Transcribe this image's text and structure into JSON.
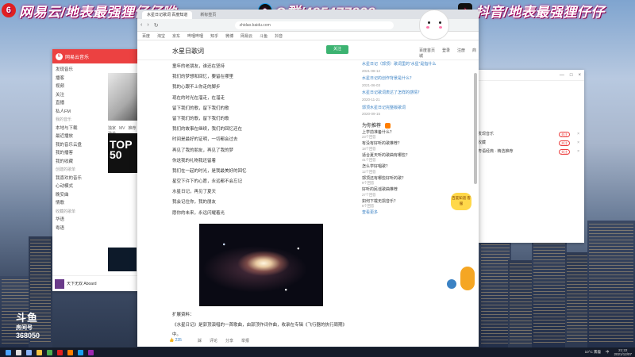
{
  "banners": {
    "left": {
      "logo": "6",
      "text": "网易云/地表最强狸仔仔哟"
    },
    "mid": {
      "text": "Q群/485477828"
    },
    "right": {
      "text": "抖音/地表最强狸仔仔"
    }
  },
  "music_window": {
    "app_title": "网易云音乐",
    "sidebar_items": [
      {
        "label": "发现音乐",
        "type": "item"
      },
      {
        "label": "播客",
        "type": "item"
      },
      {
        "label": "视频",
        "type": "item"
      },
      {
        "label": "关注",
        "type": "item"
      },
      {
        "label": "直播",
        "type": "item"
      },
      {
        "label": "私人FM",
        "type": "item"
      },
      {
        "label": "我的音乐",
        "type": "group"
      },
      {
        "label": "本地与下载",
        "type": "item"
      },
      {
        "label": "最近播放",
        "type": "item"
      },
      {
        "label": "我的音乐云盘",
        "type": "item"
      },
      {
        "label": "我的播客",
        "type": "item"
      },
      {
        "label": "我的收藏",
        "type": "item"
      },
      {
        "label": "创建的歌单",
        "type": "group"
      },
      {
        "label": "我喜欢的音乐",
        "type": "item"
      },
      {
        "label": "心动模式",
        "type": "item"
      },
      {
        "label": "晚安曲",
        "type": "item"
      },
      {
        "label": "情歌",
        "type": "item"
      },
      {
        "label": "收藏的歌单",
        "type": "group"
      },
      {
        "label": "华语",
        "type": "item"
      },
      {
        "label": "粤语",
        "type": "item"
      }
    ],
    "tabs": [
      "独家",
      "MV",
      "推荐",
      "歌单"
    ],
    "cover_text": "TOP 50",
    "now_playing": "天下无双 Aboard"
  },
  "right_window": {
    "controls": [
      "—",
      "□",
      "×"
    ],
    "rows": [
      {
        "label": "发现音乐",
        "pill": "关注"
      },
      {
        "label": "收藏",
        "pill": "关注"
      },
      {
        "label": "粤语经典 · 精选推荐",
        "pill": "关注"
      }
    ]
  },
  "browser": {
    "url": "zhidao.baidu.com",
    "tabs": [
      {
        "label": "水星日记歌词 百度知道",
        "active": true
      },
      {
        "label": "新标签页",
        "active": false
      }
    ],
    "bookmarks": [
      "百度",
      "淘宝",
      "京东",
      "哔哩哔哩",
      "知乎",
      "微博",
      "网易云",
      "斗鱼",
      "抖音"
    ],
    "page_title": "水星日歌词",
    "follow_label": "关注",
    "menu": [
      "百度首页",
      "登录",
      "注册",
      "商城"
    ],
    "lyrics": [
      "童年的老朋友，谁还在坚持",
      "我们的梦想和回忆，要留在哪里",
      "我的心跟不上你走的脚步",
      "现在的时光在溜走，在溜走",
      "留下我们的歌，留下我们的歌",
      "留下我们的歌，留下我们的歌",
      "我们的故事在继续，我们的回忆还在",
      "时间是最好的证明，一切都会过去",
      "再见了我的朋友，再见了我的梦",
      "你送我的礼物我还留着",
      "我们在一起的时光，是我最美好的回忆",
      "星空下许下的心愿，永远都不会忘记",
      "水星日记，再见了夏天",
      "我会记住你，我的朋友",
      "愿你的未来，永远闪耀着光"
    ],
    "subtitle": "扩展资料：",
    "intro": "《水星日记》是郭顶演唱的一首歌曲，由郭顶作词作曲，收录在专辑《飞行器的执行周期》中。",
    "actions": {
      "like": "235",
      "dislike": "踩",
      "comment": "评论",
      "share": "分享",
      "report": "举报"
    }
  },
  "sidebar": {
    "related": [
      {
        "text": "水星日记（郭顶）歌词里的“水星”是指什么",
        "meta": "2021-08-12"
      },
      {
        "text": "水星日记的创作背景是什么？",
        "meta": "2021-06-03"
      },
      {
        "text": "水星日记歌词表达了怎样的感情？",
        "meta": "2020-11-21"
      },
      {
        "text": "郭顶水星日记完整版歌词",
        "meta": "2020-09-15"
      }
    ],
    "hot_title": "为你推荐",
    "questions": [
      {
        "q": "上学前准备什么？",
        "a": "23个回答"
      },
      {
        "q": "有没有好听的歌推荐？",
        "a": "18个回答"
      },
      {
        "q": "适合夏天听的歌曲有哪些？",
        "a": "41个回答"
      },
      {
        "q": "怎么学好唱歌？",
        "a": "12个回答"
      },
      {
        "q": "郭顶还有哪些好听的歌？",
        "a": "9个回答"
      },
      {
        "q": "好听的民谣歌曲推荐",
        "a": "27个回答"
      },
      {
        "q": "如何下载无损音乐？",
        "a": "6个回答"
      }
    ],
    "more": "查看更多"
  },
  "mascot_text": "百度知道 客服",
  "douyu": {
    "brand": "斗鱼",
    "room_label": "房间号",
    "room_number": "368050"
  },
  "taskbar": {
    "weather": "10°C 雾霾",
    "time": "21:22",
    "date": "2021/12/07",
    "ime": "中"
  }
}
